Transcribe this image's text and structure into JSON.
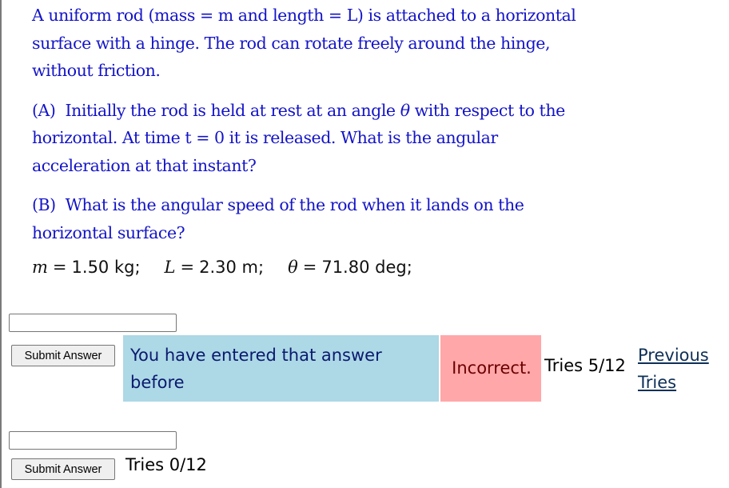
{
  "problem": {
    "intro": "A uniform rod (mass = m and length = L) is attached to a horizontal surface with a hinge. The rod can rotate freely around the hinge, without friction.",
    "part_a": {
      "label": "(A)",
      "text_before": "Initially the rod is held at rest at an angle ",
      "symbol": "θ",
      "text_after": " with respect to the horizontal. At time t = 0 it is released. What is the angular acceleration at that instant?"
    },
    "part_b": {
      "label": "(B)",
      "text": "What is the angular speed of the rod when it lands on the horizontal surface?"
    }
  },
  "givens": [
    {
      "symbol": "m",
      "equals": "=",
      "value": "1.50 kg;"
    },
    {
      "symbol": "L",
      "equals": "=",
      "value": "2.30 m;"
    },
    {
      "symbol": "θ",
      "equals": "=",
      "value": "71.80 deg;"
    }
  ],
  "answers": [
    {
      "input_value": "",
      "submit_label": "Submit Answer",
      "feedback_message": "You have entered that answer before",
      "feedback_status": "Incorrect.",
      "tries": "Tries 5/12",
      "previous_tries_link": "Previous Tries"
    },
    {
      "input_value": "",
      "submit_label": "Submit Answer",
      "tries": "Tries 0/12"
    }
  ],
  "colors": {
    "question_text": "#1414c8",
    "repeat_feedback_bg": "#add8e6",
    "incorrect_bg": "#ffa7a9",
    "incorrect_text": "#6b0000",
    "link": "#0f3057"
  }
}
